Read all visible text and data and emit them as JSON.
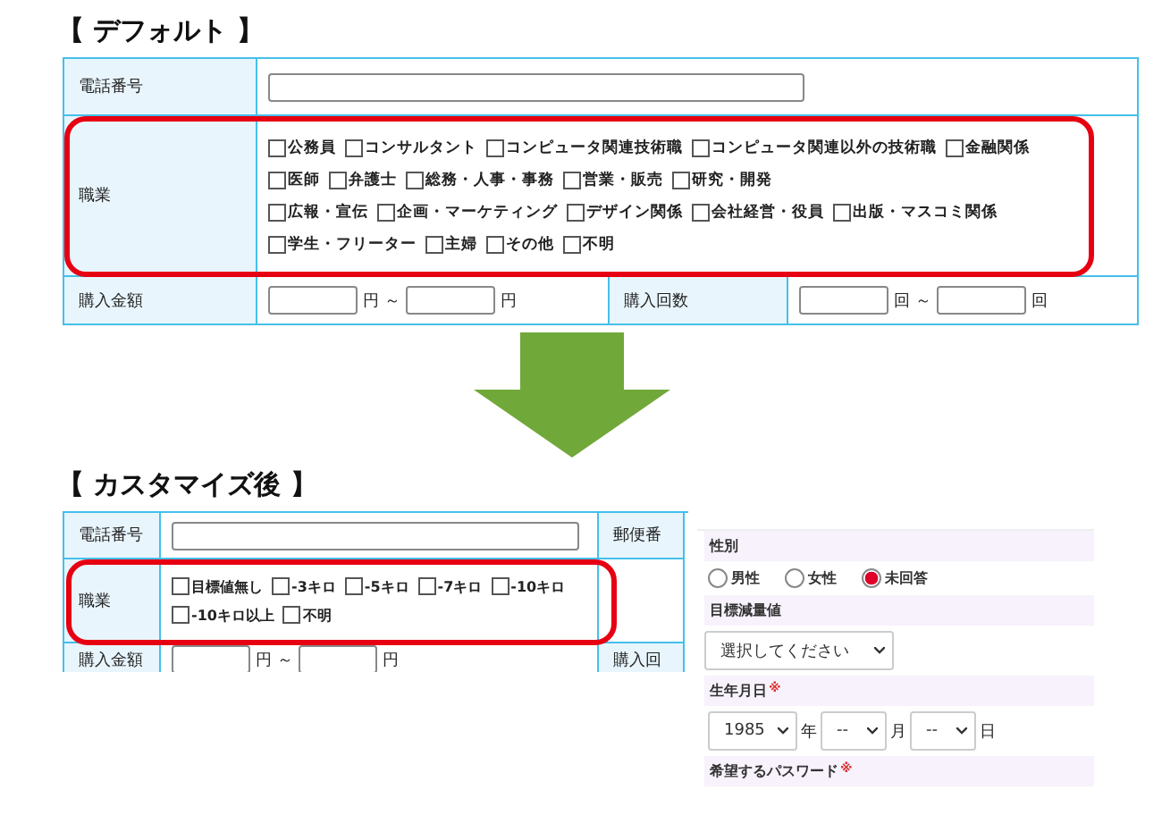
{
  "before": {
    "heading": "【 デフォルト 】",
    "phone": {
      "label": "電話番号"
    },
    "occupation": {
      "label": "職業",
      "lines": [
        [
          {
            "label": "公務員",
            "checked": false
          },
          {
            "label": "コンサルタント",
            "checked": false
          },
          {
            "label": "コンピュータ関連技術職",
            "checked": false
          },
          {
            "label": "コンピュータ関連以外の技術職",
            "checked": false
          },
          {
            "label": "金融関係",
            "checked": false
          }
        ],
        [
          {
            "label": "医師",
            "checked": false
          },
          {
            "label": "弁護士",
            "checked": false
          },
          {
            "label": "総務・人事・事務",
            "checked": false
          },
          {
            "label": "営業・販売",
            "checked": false
          },
          {
            "label": "研究・開発",
            "checked": false
          }
        ],
        [
          {
            "label": "広報・宣伝",
            "checked": false
          },
          {
            "label": "企画・マーケティング",
            "checked": false
          },
          {
            "label": "デザイン関係",
            "checked": false
          },
          {
            "label": "会社経営・役員",
            "checked": false
          },
          {
            "label": "出版・マスコミ関係",
            "checked": false
          }
        ],
        [
          {
            "label": "学生・フリーター",
            "checked": false
          },
          {
            "label": "主婦",
            "checked": false
          },
          {
            "label": "その他",
            "checked": false
          },
          {
            "label": "不明",
            "checked": false
          }
        ]
      ]
    },
    "purchase": {
      "amount_label": "購入金額",
      "amount_from_unit": "円 ～",
      "amount_to_unit": "円",
      "count_label": "購入回数",
      "count_from_unit": "回 ～",
      "count_to_unit": "回"
    }
  },
  "after": {
    "heading": "【 カスタマイズ後 】",
    "phone": {
      "label": "電話番号",
      "column_3": "郵便番"
    },
    "occupation": {
      "label": "職業",
      "lines": [
        [
          {
            "label": "目標値無し",
            "checked": false
          },
          {
            "label": "-3キロ",
            "checked": false
          },
          {
            "label": "-5キロ",
            "checked": false
          },
          {
            "label": "-7キロ",
            "checked": false
          },
          {
            "label": "-10キロ",
            "checked": false
          }
        ],
        [
          {
            "label": "-10キロ以上",
            "checked": false
          },
          {
            "label": "不明",
            "checked": false
          }
        ]
      ]
    },
    "purchase": {
      "amount_label": "購入金額",
      "amount_from_unit": "円 ～",
      "amount_to_unit": "円",
      "column_3": "購入回"
    }
  },
  "form": {
    "gender": {
      "label": "性別",
      "options": [
        {
          "label": "男性",
          "selected": false
        },
        {
          "label": "女性",
          "selected": false
        },
        {
          "label": "未回答",
          "selected": true
        }
      ]
    },
    "target": {
      "label": "目標減量値",
      "value": "選択してください"
    },
    "birthday": {
      "label": "生年月日",
      "required": "※",
      "year": "1985",
      "year_unit": "年",
      "month": "--",
      "month_unit": "月",
      "day": "--",
      "day_unit": "日"
    },
    "password": {
      "label": "希望するパスワード",
      "required": "※"
    }
  }
}
